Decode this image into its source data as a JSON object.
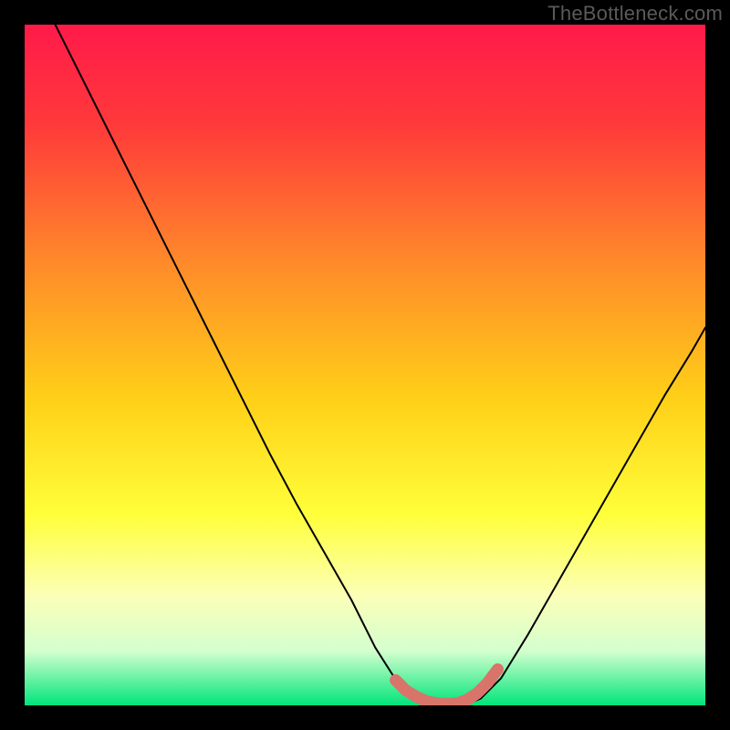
{
  "watermark": "TheBottleneck.com",
  "chart_data": {
    "type": "line",
    "title": "",
    "xlabel": "",
    "ylabel": "",
    "xlim": [
      0,
      1
    ],
    "ylim": [
      0,
      1
    ],
    "background_gradient": [
      {
        "offset": 0.0,
        "color": "#ff1a4a"
      },
      {
        "offset": 0.15,
        "color": "#ff3a3a"
      },
      {
        "offset": 0.35,
        "color": "#ff8a2a"
      },
      {
        "offset": 0.55,
        "color": "#ffd018"
      },
      {
        "offset": 0.72,
        "color": "#ffff3a"
      },
      {
        "offset": 0.84,
        "color": "#fbffb8"
      },
      {
        "offset": 0.92,
        "color": "#d4ffcf"
      },
      {
        "offset": 1.0,
        "color": "#00e57a"
      }
    ],
    "series": [
      {
        "name": "curve",
        "color": "#000000",
        "stroke_width": 2,
        "x": [
          0.045,
          0.08,
          0.12,
          0.16,
          0.2,
          0.24,
          0.28,
          0.32,
          0.36,
          0.4,
          0.44,
          0.48,
          0.515,
          0.55,
          0.585,
          0.62,
          0.645,
          0.67,
          0.7,
          0.74,
          0.78,
          0.82,
          0.86,
          0.9,
          0.94,
          0.98,
          1.0
        ],
        "y": [
          1.0,
          0.93,
          0.85,
          0.77,
          0.69,
          0.61,
          0.53,
          0.45,
          0.37,
          0.295,
          0.225,
          0.155,
          0.085,
          0.03,
          0.005,
          0.0,
          0.0,
          0.01,
          0.04,
          0.105,
          0.175,
          0.245,
          0.315,
          0.385,
          0.455,
          0.52,
          0.555
        ]
      },
      {
        "name": "highlight",
        "color": "#d9746b",
        "stroke_width": 13,
        "x": [
          0.545,
          0.56,
          0.575,
          0.59,
          0.605,
          0.62,
          0.635,
          0.65,
          0.665,
          0.68,
          0.695
        ],
        "y": [
          0.037,
          0.022,
          0.013,
          0.006,
          0.003,
          0.002,
          0.003,
          0.008,
          0.018,
          0.033,
          0.053
        ]
      }
    ]
  }
}
